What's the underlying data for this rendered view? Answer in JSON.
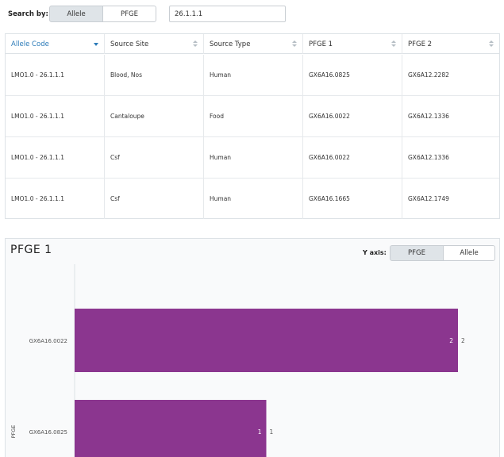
{
  "search": {
    "label": "Search by:",
    "options": [
      "Allele",
      "PFGE"
    ],
    "selected": "Allele",
    "value": "26.1.1.1"
  },
  "table": {
    "columns": [
      "Allele Code",
      "Source Site",
      "Source Type",
      "PFGE 1",
      "PFGE 2"
    ],
    "sorted_column": "Allele Code",
    "rows": [
      [
        "LMO1.0 - 26.1.1.1",
        "Blood, Nos",
        "Human",
        "GX6A16.0825",
        "GX6A12.2282"
      ],
      [
        "LMO1.0 - 26.1.1.1",
        "Cantaloupe",
        "Food",
        "GX6A16.0022",
        "GX6A12.1336"
      ],
      [
        "LMO1.0 - 26.1.1.1",
        "Csf",
        "Human",
        "GX6A16.0022",
        "GX6A12.1336"
      ],
      [
        "LMO1.0 - 26.1.1.1",
        "Csf",
        "Human",
        "GX6A16.1665",
        "GX6A12.1749"
      ]
    ]
  },
  "chart_panel": {
    "title": "PFGE 1",
    "yaxis_label": "Y axis:",
    "yaxis_options": [
      "PFGE",
      "Allele"
    ],
    "yaxis_selected": "PFGE"
  },
  "chart_data": {
    "type": "bar",
    "orientation": "horizontal",
    "title": "PFGE 1",
    "ylabel": "PFGE",
    "xlabel": "",
    "categories": [
      "GX6A16.0022",
      "GX6A16.0825"
    ],
    "values": [
      2,
      1
    ],
    "bar_labels": [
      "2",
      "1"
    ],
    "bar_color": "#8b368f",
    "xlim": [
      0,
      2
    ]
  },
  "colors": {
    "accent": "#2a7ab8",
    "bar": "#8b368f",
    "selected_toggle": "#dfe4e8"
  }
}
